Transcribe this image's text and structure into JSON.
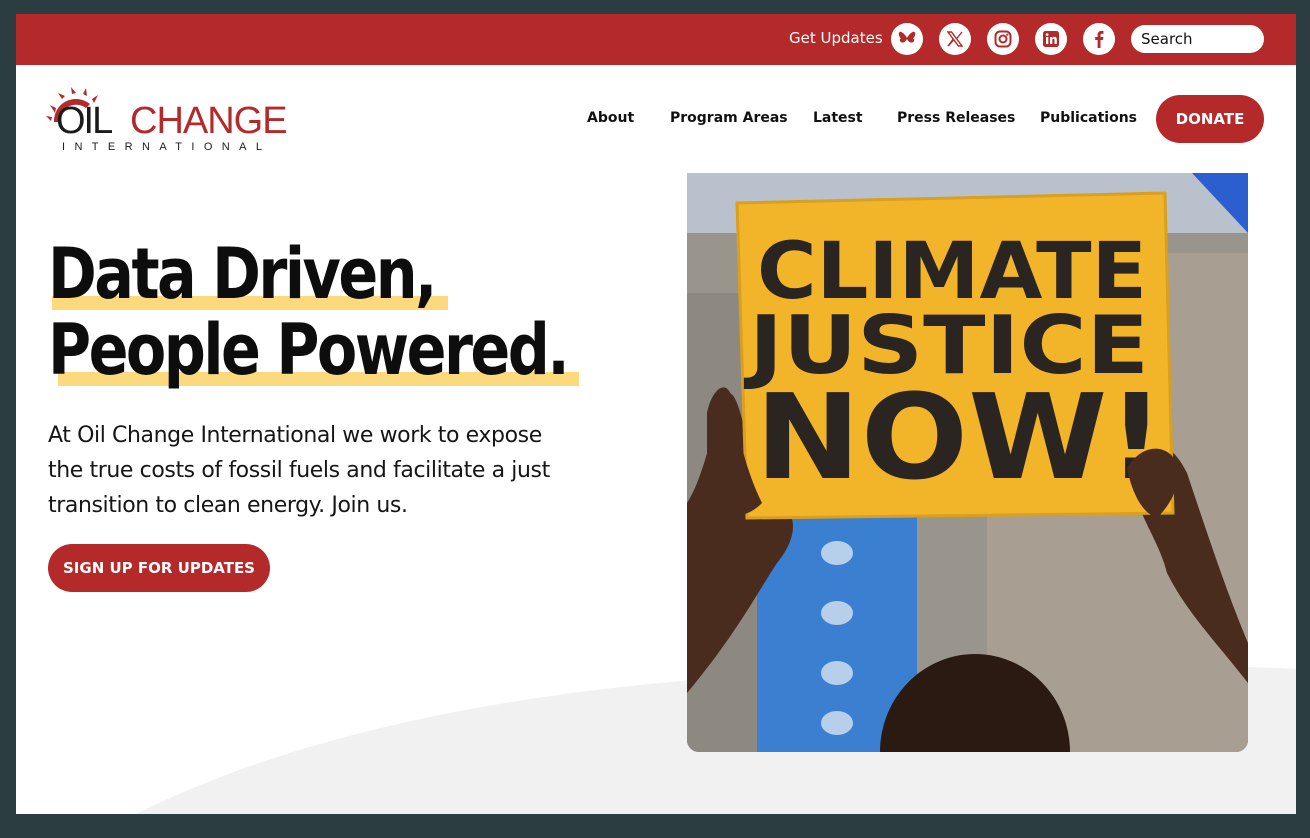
{
  "topbar": {
    "get_updates": "Get Updates",
    "social": [
      {
        "name": "bluesky-icon"
      },
      {
        "name": "x-icon"
      },
      {
        "name": "instagram-icon"
      },
      {
        "name": "linkedin-icon"
      },
      {
        "name": "facebook-icon"
      }
    ],
    "search_placeholder": "Search"
  },
  "logo": {
    "oil": "OIL",
    "change": "CHANGE",
    "international": "INTERNATIONAL"
  },
  "nav": {
    "items": [
      {
        "label": "About"
      },
      {
        "label": "Program Areas"
      },
      {
        "label": "Latest"
      },
      {
        "label": "Press Releases"
      },
      {
        "label": "Publications"
      }
    ],
    "donate": "DONATE"
  },
  "hero": {
    "headline_line1": "Data Driven,",
    "headline_line2": "People Powered.",
    "intro": "At Oil Change International we work to expose the true costs of fossil fuels and facilitate a just transition to clean energy. Join us.",
    "signup": "SIGN UP FOR UPDATES",
    "photo_sign": [
      "CLIMATE",
      "JUSTICE",
      "NOW!"
    ]
  },
  "colors": {
    "brand_red": "#b42a2a",
    "highlight_yellow": "#fcd97c",
    "frame_bg": "#2b3d40"
  }
}
